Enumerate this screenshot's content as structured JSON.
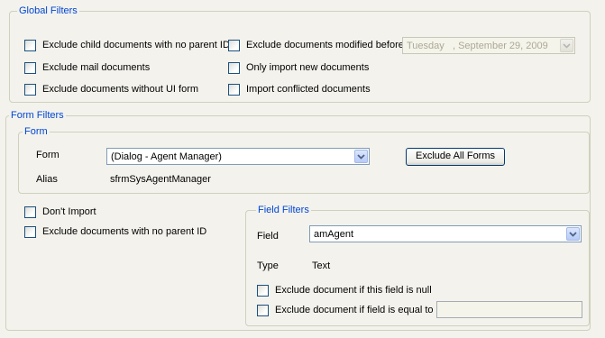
{
  "global_filters": {
    "legend": "Global Filters",
    "options": [
      {
        "label": "Exclude child documents with no parent ID",
        "checked": false
      },
      {
        "label": "Exclude documents modified before",
        "checked": false
      },
      {
        "label": "Exclude mail documents",
        "checked": false
      },
      {
        "label": "Only import new documents",
        "checked": false
      },
      {
        "label": "Exclude documents without UI form",
        "checked": false
      },
      {
        "label": "Import conflicted documents",
        "checked": false
      }
    ],
    "date_value": "Tuesday   , September 29, 2009"
  },
  "form_filters": {
    "legend": "Form Filters",
    "form_group": {
      "legend": "Form",
      "form_label": "Form",
      "form_value": "(Dialog - Agent Manager)",
      "alias_label": "Alias",
      "alias_value": "sfrmSysAgentManager",
      "exclude_all_label": "Exclude All Forms"
    },
    "dont_import_label": "Don't Import",
    "exclude_no_parent_label": "Exclude documents with no parent ID",
    "field_filters": {
      "legend": "Field Filters",
      "field_label": "Field",
      "field_value": "amAgent",
      "type_label": "Type",
      "type_value": "Text",
      "exclude_null_label": "Exclude document if this field is null",
      "exclude_equal_label": "Exclude document if field is equal to",
      "equal_value": ""
    }
  },
  "icons": {
    "dropdown": "chevron-down-icon"
  },
  "colors": {
    "legend": "#0046d5",
    "panel": "#f3f2ec",
    "border": "#d0d0bf"
  }
}
